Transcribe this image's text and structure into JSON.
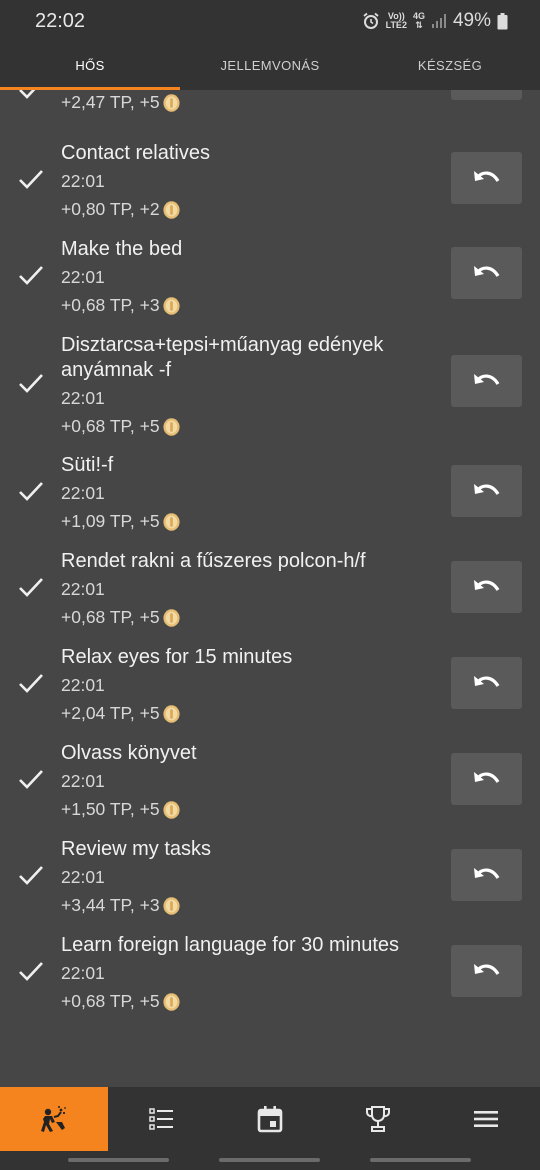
{
  "status_bar": {
    "time": "22:02",
    "volte_top": "Vo))",
    "volte_bottom": "LTE2",
    "network": "4G",
    "battery": "49%"
  },
  "tabs": [
    {
      "label": "HŐS",
      "active": true
    },
    {
      "label": "JELLEMVONÁS",
      "active": false
    },
    {
      "label": "KÉSZSÉG",
      "active": false
    }
  ],
  "partial_item": {
    "reward": "+2,47 TP, +5"
  },
  "tasks": [
    {
      "title": "Contact relatives",
      "time": "22:01",
      "reward": "+0,80 TP, +2"
    },
    {
      "title": "Make the bed",
      "time": "22:01",
      "reward": "+0,68 TP, +3"
    },
    {
      "title": "Disztarcsa+tepsi+műanyag edények anyámnak -f",
      "time": "22:01",
      "reward": "+0,68 TP, +5"
    },
    {
      "title": "Süti!-f",
      "time": "22:01",
      "reward": "+1,09 TP, +5"
    },
    {
      "title": "Rendet rakni a fűszeres polcon-h/f",
      "time": "22:01",
      "reward": "+0,68 TP, +5"
    },
    {
      "title": "Relax eyes for 15 minutes",
      "time": "22:01",
      "reward": "+2,04 TP, +5"
    },
    {
      "title": "Olvass könyvet",
      "time": "22:01",
      "reward": "+1,50 TP, +5"
    },
    {
      "title": "Review my tasks",
      "time": "22:01",
      "reward": "+3,44 TP, +3"
    },
    {
      "title": "Learn foreign language for 30 minutes",
      "time": "22:01",
      "reward": "+0,68 TP, +5"
    }
  ],
  "icons": {
    "completed": "check-icon",
    "undo": "undo-icon",
    "currency": "coin-icon"
  },
  "bottom_nav": [
    {
      "icon": "hero-icon",
      "active": true
    },
    {
      "icon": "checklist-icon",
      "active": false
    },
    {
      "icon": "calendar-icon",
      "active": false
    },
    {
      "icon": "trophy-icon",
      "active": false
    },
    {
      "icon": "menu-icon",
      "active": false
    }
  ],
  "colors": {
    "accent": "#f5841f",
    "background": "#464646",
    "bars": "#333333",
    "button": "#5a5a5a",
    "coin": "#e8c27a"
  }
}
